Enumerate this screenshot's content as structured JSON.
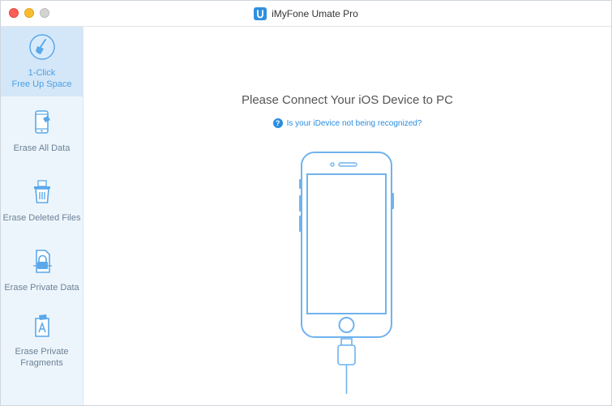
{
  "window": {
    "title": "iMyFone Umate Pro",
    "logo_letter": "U"
  },
  "sidebar": {
    "items": [
      {
        "label": "1-Click\nFree Up Space",
        "icon": "broom-icon",
        "active": true
      },
      {
        "label": "Erase All Data",
        "icon": "phone-erase-icon",
        "active": false
      },
      {
        "label": "Erase Deleted Files",
        "icon": "trash-files-icon",
        "active": false
      },
      {
        "label": "Erase Private Data",
        "icon": "private-data-icon",
        "active": false
      },
      {
        "label": "Erase Private\nFragments",
        "icon": "fragments-icon",
        "active": false
      }
    ]
  },
  "main": {
    "heading": "Please Connect Your iOS Device to PC",
    "help_icon": "?",
    "help_link": "Is your iDevice not being recognized?"
  },
  "colors": {
    "accent": "#4a9fe6",
    "link": "#2a8de0",
    "sidebar_bg": "#edf5fc",
    "sidebar_active_bg": "#d4e7f8",
    "phone_outline": "#6fb3ee"
  }
}
